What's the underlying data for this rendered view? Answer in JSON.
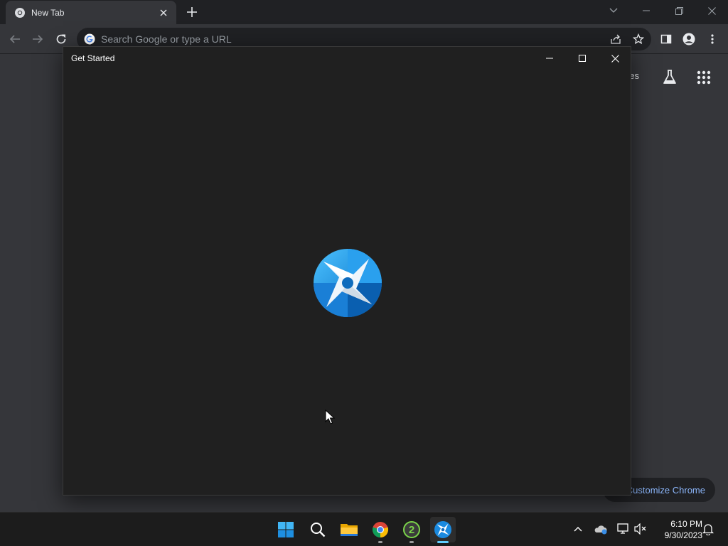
{
  "browser": {
    "tab": {
      "title": "New Tab",
      "favicon": "chrome-icon"
    },
    "omnibox": {
      "placeholder": "Search Google or type a URL"
    },
    "ntp": {
      "images_link": "ges",
      "customize_label": "Customize Chrome"
    }
  },
  "get_started_window": {
    "title": "Get Started",
    "logo": "get-started-logo-icon"
  },
  "taskbar": {
    "pinned": [
      "start-icon",
      "search-icon",
      "file-explorer-icon",
      "chrome-icon",
      "app-2-icon",
      "get-started-icon"
    ],
    "clock": {
      "time": "6:10 PM",
      "date": "9/30/2023"
    }
  },
  "colors": {
    "accent": "#60cdff",
    "link": "#8ab4f8",
    "logo_light": "#4cc2ff",
    "logo_dark": "#0067c0"
  }
}
